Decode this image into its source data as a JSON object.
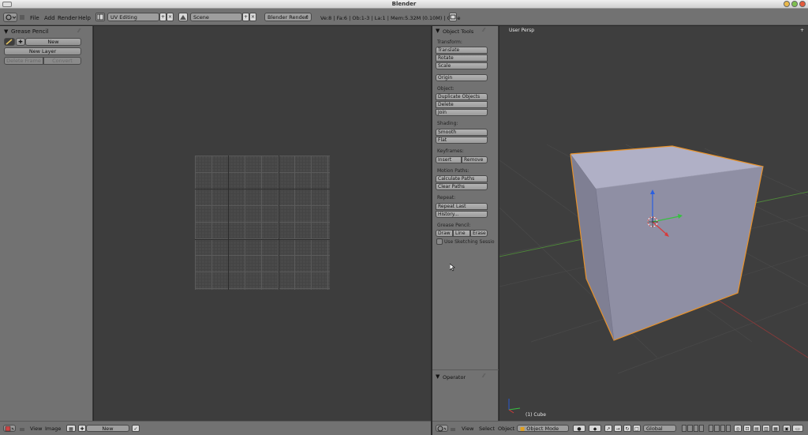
{
  "window": {
    "title": "Blender"
  },
  "info_header": {
    "menus": [
      "File",
      "Add",
      "Render",
      "Help"
    ],
    "screen_layout": "UV Editing",
    "scene": "Scene",
    "render_engine": "Blender Render",
    "stats": "Ve:8 | Fa:6 | Ob:1-3 | La:1 | Mem:5.32M (0.10M) | Cube"
  },
  "grease_pencil_panel": {
    "title": "Grease Pencil",
    "new_label": "New",
    "new_layer_label": "New Layer",
    "delete_frame_label": "Delete Frame",
    "convert_label": "Convert"
  },
  "uv_editor_header": {
    "menus": [
      "View",
      "Image"
    ],
    "image_field": "New"
  },
  "tool_shelf": {
    "title": "Object Tools",
    "transform": {
      "label": "Transform:",
      "buttons": [
        "Translate",
        "Rotate",
        "Scale"
      ]
    },
    "origin_label": "Origin",
    "object": {
      "label": "Object:",
      "buttons": [
        "Duplicate Objects",
        "Delete",
        "Join"
      ]
    },
    "shading": {
      "label": "Shading:",
      "buttons": [
        "Smooth",
        "Flat"
      ]
    },
    "keyframes": {
      "label": "Keyframes:",
      "insert": "Insert",
      "remove": "Remove"
    },
    "motion_paths": {
      "label": "Motion Paths:",
      "buttons": [
        "Calculate Paths",
        "Clear Paths"
      ]
    },
    "repeat": {
      "label": "Repeat:",
      "buttons": [
        "Repeat Last",
        "History..."
      ]
    },
    "grease_pencil": {
      "label": "Grease Pencil:",
      "draw": "Draw",
      "line": "Line",
      "erase": "Erase"
    },
    "sketching_label": "Use Sketching Sessio",
    "operator_title": "Operator"
  },
  "viewport": {
    "view_name": "User Persp",
    "object_label": "(1) Cube",
    "colors": {
      "cube_top": "#b0b0c6",
      "cube_front": "#8f8fa4",
      "cube_side": "#7f7f93",
      "outline": "#e8922a"
    }
  },
  "viewport_header": {
    "menus": [
      "View",
      "Select",
      "Object"
    ],
    "mode": "Object Mode",
    "orientation": "Global"
  }
}
